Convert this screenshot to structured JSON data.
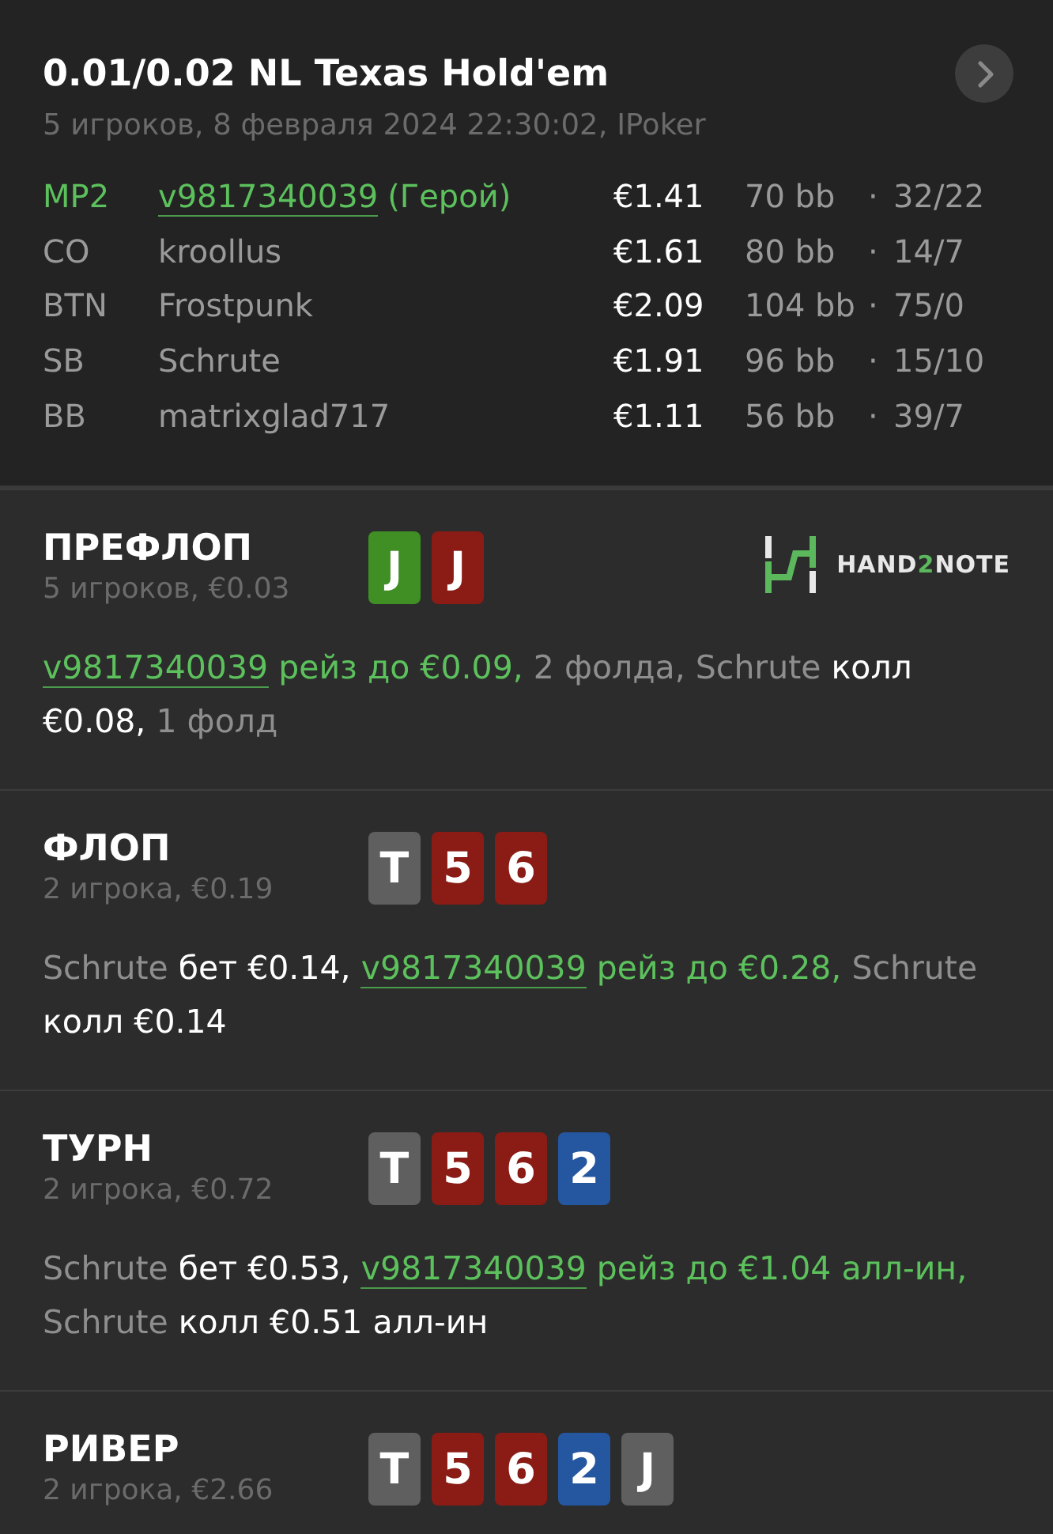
{
  "header": {
    "title": "0.01/0.02 NL Texas Hold'em",
    "subtitle": "5 игроков, 8 февраля 2024 22:30:02, IPoker",
    "players": [
      {
        "position": "MP2",
        "name": "v9817340039",
        "note": "(Герой)",
        "hero": true,
        "stack": "€1.41",
        "bb": "70 bb",
        "dot": "·",
        "stats": "32/22"
      },
      {
        "position": "CO",
        "name": "kroollus",
        "hero": false,
        "stack": "€1.61",
        "bb": "80 bb",
        "dot": "·",
        "stats": "14/7"
      },
      {
        "position": "BTN",
        "name": "Frostpunk",
        "hero": false,
        "stack": "€2.09",
        "bb": "104 bb",
        "dot": "·",
        "stats": "75/0"
      },
      {
        "position": "SB",
        "name": "Schrute",
        "hero": false,
        "stack": "€1.91",
        "bb": "96 bb",
        "dot": "·",
        "stats": "15/10"
      },
      {
        "position": "BB",
        "name": "matrixglad717",
        "hero": false,
        "stack": "€1.11",
        "bb": "56 bb",
        "dot": "·",
        "stats": "39/7"
      }
    ]
  },
  "logo": {
    "parts": [
      {
        "text": "HAND",
        "accent": false
      },
      {
        "text": "2",
        "accent": true
      },
      {
        "text": "NOTE",
        "accent": false
      }
    ]
  },
  "streets": [
    {
      "title": "ПРЕФЛОП",
      "info": "5 игроков, €0.03",
      "logo": true,
      "cards": [
        {
          "rank": "J",
          "color": "#3f8f25"
        },
        {
          "rank": "J",
          "color": "#8a1c15"
        }
      ],
      "actions": [
        {
          "kind": "link",
          "text": "v9817340039"
        },
        {
          "kind": "hero",
          "text": " рейз до €0.09,"
        },
        {
          "kind": "muted",
          "text": " 2 фолда, Schrute"
        },
        {
          "kind": "plain",
          "text": " колл €0.08,"
        },
        {
          "kind": "muted",
          "text": " 1 фолд"
        }
      ]
    },
    {
      "title": "ФЛОП",
      "info": "2 игрока, €0.19",
      "cards": [
        {
          "rank": "T",
          "color": "#5f5f5f"
        },
        {
          "rank": "5",
          "color": "#8a1c15"
        },
        {
          "rank": "6",
          "color": "#8a1c15"
        }
      ],
      "actions": [
        {
          "kind": "muted",
          "text": "Schrute"
        },
        {
          "kind": "plain",
          "text": " бет €0.14, "
        },
        {
          "kind": "link",
          "text": "v9817340039"
        },
        {
          "kind": "hero",
          "text": " рейз до €0.28,"
        },
        {
          "kind": "muted",
          "text": " Schrute"
        },
        {
          "kind": "plain",
          "text": " колл €0.14"
        }
      ]
    },
    {
      "title": "ТУРН",
      "info": "2 игрока, €0.72",
      "cards": [
        {
          "rank": "T",
          "color": "#5f5f5f"
        },
        {
          "rank": "5",
          "color": "#8a1c15"
        },
        {
          "rank": "6",
          "color": "#8a1c15"
        },
        {
          "rank": "2",
          "color": "#2556a0"
        }
      ],
      "actions": [
        {
          "kind": "muted",
          "text": "Schrute"
        },
        {
          "kind": "plain",
          "text": " бет €0.53, "
        },
        {
          "kind": "link",
          "text": "v9817340039"
        },
        {
          "kind": "hero",
          "text": " рейз до €1.04 алл-ин,"
        },
        {
          "kind": "muted",
          "text": " Schrute"
        },
        {
          "kind": "plain",
          "text": " колл €0.51 алл-ин"
        }
      ]
    },
    {
      "title": "РИВЕР",
      "info": "2 игрока, €2.66",
      "cards": [
        {
          "rank": "T",
          "color": "#5f5f5f"
        },
        {
          "rank": "5",
          "color": "#8a1c15"
        },
        {
          "rank": "6",
          "color": "#8a1c15"
        },
        {
          "rank": "2",
          "color": "#2556a0"
        },
        {
          "rank": "J",
          "color": "#5f5f5f"
        }
      ]
    }
  ]
}
